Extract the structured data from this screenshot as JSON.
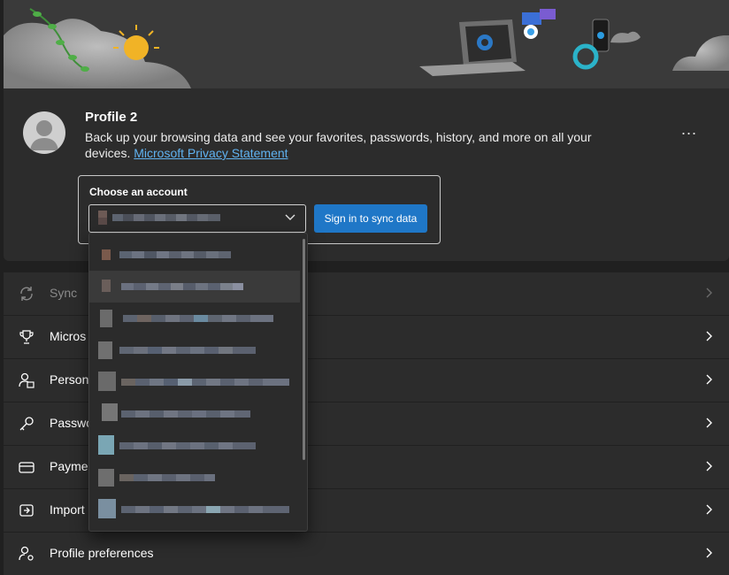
{
  "profile": {
    "name": "Profile 2",
    "description": "Back up your browsing data and see your favorites, passwords, history, and more on all your devices.",
    "privacy_link": "Microsoft Privacy Statement",
    "more_label": "..."
  },
  "account": {
    "label": "Choose an account",
    "selected_value": "",
    "sync_button": "Sign in to sync data"
  },
  "settings": {
    "items": [
      {
        "label": "Sync",
        "icon": "sync-icon",
        "disabled": true
      },
      {
        "label": "Micros",
        "icon": "rewards-trophy-icon"
      },
      {
        "label": "Persona",
        "icon": "personal-info-icon"
      },
      {
        "label": "Passwo",
        "icon": "key-icon"
      },
      {
        "label": "Paymen",
        "icon": "credit-card-icon"
      },
      {
        "label": "Import",
        "icon": "import-icon"
      },
      {
        "label": "Profile preferences",
        "icon": "profile-settings-icon"
      }
    ]
  },
  "account_dropdown": {
    "items": [
      "",
      "",
      "",
      "",
      "",
      "",
      "",
      "",
      ""
    ],
    "highlighted_index": 1
  },
  "colors": {
    "accent": "#1f77c7",
    "link": "#60b2f0",
    "card_bg": "#2c2c2c",
    "page_bg": "#202020"
  }
}
